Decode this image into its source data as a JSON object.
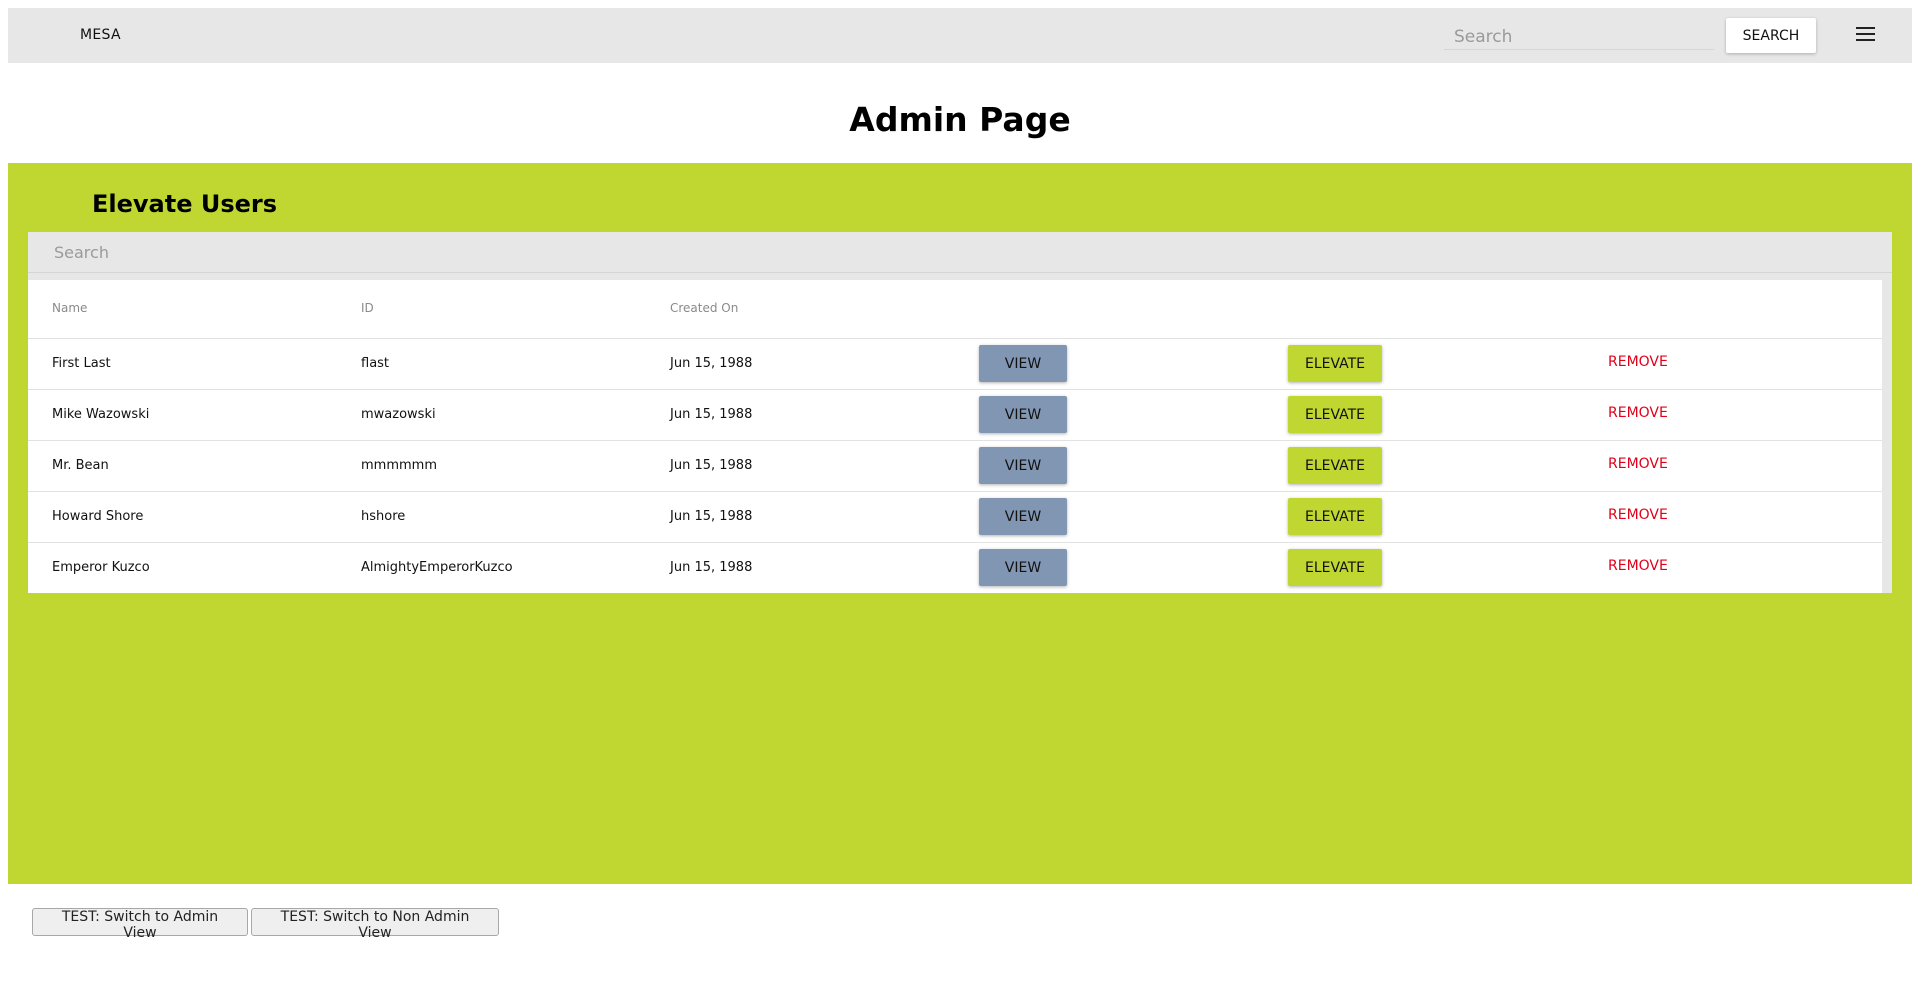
{
  "header": {
    "brand": "MESA",
    "search_placeholder": "Search",
    "search_button": "SEARCH",
    "menu_icon": "hamburger-menu-icon"
  },
  "page": {
    "title": "Admin Page"
  },
  "panel": {
    "title": "Elevate Users",
    "search_placeholder": "Search",
    "columns": [
      "Name",
      "ID",
      "Created On"
    ],
    "rows": [
      {
        "name": "First Last",
        "id": "flast",
        "created": "Jun 15, 1988",
        "view": "VIEW",
        "elevate": "ELEVATE",
        "remove": "REMOVE"
      },
      {
        "name": "Mike Wazowski",
        "id": "mwazowski",
        "created": "Jun 15, 1988",
        "view": "VIEW",
        "elevate": "ELEVATE",
        "remove": "REMOVE"
      },
      {
        "name": "Mr. Bean",
        "id": "mmmmmm",
        "created": "Jun 15, 1988",
        "view": "VIEW",
        "elevate": "ELEVATE",
        "remove": "REMOVE"
      },
      {
        "name": "Howard Shore",
        "id": "hshore",
        "created": "Jun 15, 1988",
        "view": "VIEW",
        "elevate": "ELEVATE",
        "remove": "REMOVE"
      },
      {
        "name": "Emperor Kuzco",
        "id": "AlmightyEmperorKuzco",
        "created": "Jun 15, 1988",
        "view": "VIEW",
        "elevate": "ELEVATE",
        "remove": "REMOVE"
      }
    ]
  },
  "test_buttons": {
    "admin_view": "TEST: Switch to Admin View",
    "non_admin_view": "TEST: Switch to Non Admin View"
  },
  "colors": {
    "accent_green": "#bfd730",
    "view_button": "#8096b3",
    "remove_red": "#e0001a",
    "topbar_gray": "#e7e7e7"
  }
}
